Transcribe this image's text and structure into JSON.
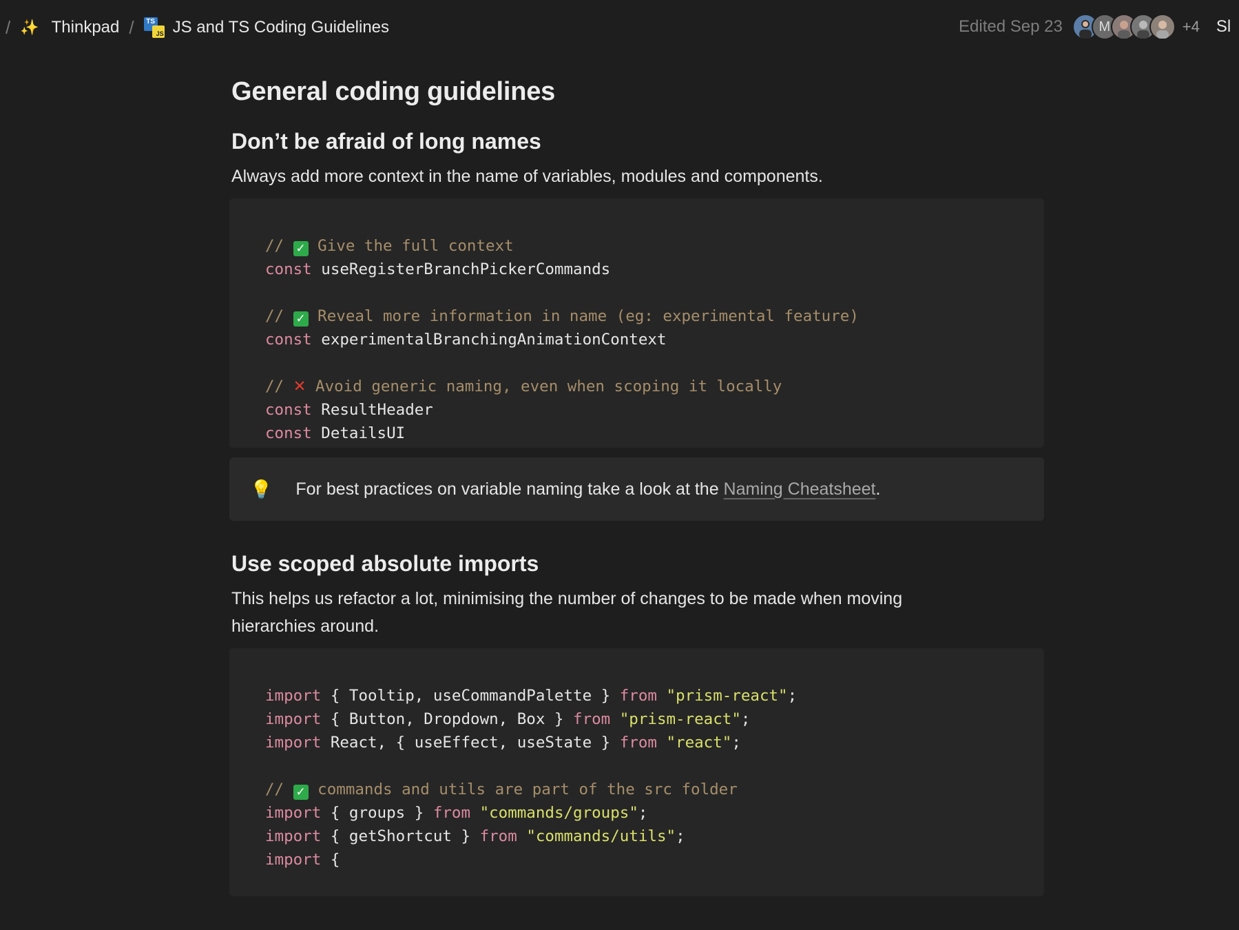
{
  "breadcrumb": {
    "separator": "/",
    "workspace_label": "Thinkpad",
    "page_label": "JS and TS Coding Guidelines",
    "page_icon": "typescript-javascript-icon",
    "workspace_icon": "sparkles-icon"
  },
  "header": {
    "edited_text": "Edited Sep 23",
    "avatar_initial": "M",
    "extra_collaborators": "+4",
    "share_label": "Sl"
  },
  "page": {
    "title": "General coding guidelines",
    "sections": [
      {
        "heading": "Don’t be afraid of long names",
        "description": "Always add more context in the name of variables, modules and components.",
        "code": [
          {
            "comment": "// ",
            "emoji": "✓",
            "text": " Give the full context"
          },
          {
            "kw": "const",
            "ident": " useRegisterBranchPickerCommands"
          },
          {
            "comment": "// ",
            "emoji": "✓",
            "text": " Reveal more information in name (eg: experimental feature)"
          },
          {
            "kw": "const",
            "ident": " experimentalBranchingAnimationContext"
          },
          {
            "comment": "// ",
            "emoji": "✕",
            "text": " Avoid generic naming, even when scoping it locally"
          },
          {
            "kw": "const",
            "ident": " ResultHeader"
          },
          {
            "kw": "const",
            "ident": " DetailsUI"
          }
        ]
      },
      {
        "heading": "Use scoped absolute imports",
        "description": "This helps us refactor a lot, minimising the number of changes to be made when moving hierarchies around.",
        "code": [
          {
            "kw": "import",
            "ident": " { Tooltip, useCommandPalette } ",
            "from": "from",
            "str": "\"prism-react\"",
            "end": ";"
          },
          {
            "kw": "import",
            "ident": " { Button, Dropdown, Box } ",
            "from": "from",
            "str": "\"prism-react\"",
            "end": ";"
          },
          {
            "kw": "import",
            "ident": " React, { useEffect, useState } ",
            "from": "from",
            "str": "\"react\"",
            "end": ";"
          },
          {
            "comment": "// ",
            "emoji": "✓",
            "text": " commands and utils are part of the src folder"
          },
          {
            "kw": "import",
            "ident": " { groups } ",
            "from": "from",
            "str": "\"commands/groups\"",
            "end": ";"
          },
          {
            "kw": "import",
            "ident": " { getShortcut } ",
            "from": "from",
            "str": "\"commands/utils\"",
            "end": ";"
          },
          {
            "kw": "import",
            "ident": " {"
          }
        ]
      }
    ],
    "callout": {
      "icon": "lightbulb-icon",
      "text": "For best practices on variable naming take a look at the ",
      "link_label": "Naming Cheatsheet",
      "suffix": "."
    }
  },
  "colors": {
    "background": "#1e1e1e",
    "code_background": "#262626",
    "comment": "#a68e6a",
    "keyword": "#dd8ba0",
    "string": "#d9e06a",
    "check_green": "#2eaa4a",
    "cross_red": "#e33b2e"
  }
}
